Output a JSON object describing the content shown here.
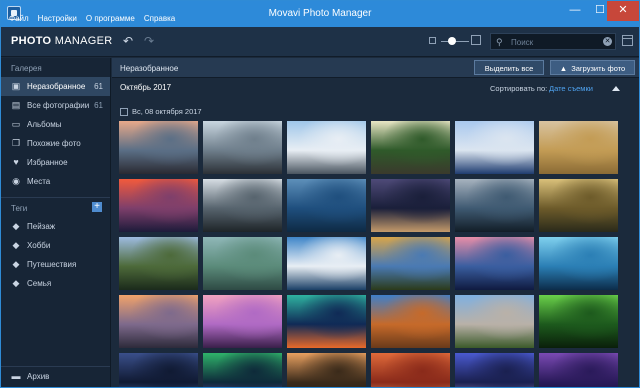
{
  "window": {
    "title": "Movavi Photo Manager",
    "min": "—",
    "max": "☐",
    "close": "✕"
  },
  "menu": [
    "Файл",
    "Настройки",
    "О программе",
    "Справка"
  ],
  "toolbar": {
    "logo_bold": "PHOTO",
    "logo_rest": " MANAGER",
    "undo": "↶",
    "redo": "↷",
    "search_placeholder": "Поиск",
    "search_icon": "⚲",
    "clear": "✕"
  },
  "sidebar": {
    "gallery_title": "Галерея",
    "items": [
      {
        "label": "Неразобранное",
        "count": "61",
        "icon": "inbox-icon",
        "glyph": "▣",
        "active": true
      },
      {
        "label": "Все фотографии",
        "count": "61",
        "icon": "photos-icon",
        "glyph": "▤"
      },
      {
        "label": "Альбомы",
        "count": "",
        "icon": "albums-icon",
        "glyph": "▭"
      },
      {
        "label": "Похожие фото",
        "count": "",
        "icon": "similar-icon",
        "glyph": "❐"
      },
      {
        "label": "Избранное",
        "count": "",
        "icon": "heart-icon",
        "glyph": "♥"
      },
      {
        "label": "Места",
        "count": "",
        "icon": "pin-icon",
        "glyph": "◉"
      }
    ],
    "tags_title": "Теги",
    "add_tag": "+",
    "tags": [
      {
        "label": "Пейзаж",
        "icon": "tag-icon",
        "glyph": "◆"
      },
      {
        "label": "Хобби",
        "icon": "tag-icon",
        "glyph": "◆"
      },
      {
        "label": "Путешествия",
        "icon": "tag-icon",
        "glyph": "◆"
      },
      {
        "label": "Семья",
        "icon": "tag-icon",
        "glyph": "◆"
      }
    ],
    "archive": {
      "label": "Архив",
      "icon": "archive-icon",
      "glyph": "▬"
    }
  },
  "main": {
    "header_title": "Неразобранное",
    "select_all": "Выделить все",
    "upload": "Загрузить фото",
    "upload_icon": "▲",
    "month": "Октябрь 2017",
    "sort_label": "Сортировать по:",
    "sort_value": "Дате съемки",
    "date_group": "Вс, 08 октября 2017"
  },
  "colors": {
    "accent": "#2d8ad9",
    "link": "#4fa3f0",
    "sidebar_bg": "#172536",
    "main_bg": "#1b2a3c"
  },
  "photos": [
    {
      "name": "pier-sunset",
      "c1": "#e8a98a",
      "c2": "#5b6f86",
      "c3": "#2a2a32"
    },
    {
      "name": "rocky-coast",
      "c1": "#c9d6e0",
      "c2": "#6f7f8c",
      "c3": "#2b3036"
    },
    {
      "name": "eagle",
      "c1": "#9fc6e9",
      "c2": "#e8eef4",
      "c3": "#4a5560"
    },
    {
      "name": "forest-road",
      "c1": "#e8e6c5",
      "c2": "#2f5a2a",
      "c3": "#3a3a2c"
    },
    {
      "name": "architecture",
      "c1": "#a9c8ee",
      "c2": "#dbe5f0",
      "c3": "#1f3c70"
    },
    {
      "name": "deer-field",
      "c1": "#d8c3a0",
      "c2": "#c39c55",
      "c3": "#8a6b35"
    },
    {
      "name": "red-sunset-lake",
      "c1": "#f25a3c",
      "c2": "#7e3f6b",
      "c3": "#1d1b3a"
    },
    {
      "name": "paraglider",
      "c1": "#d6dde3",
      "c2": "#57646e",
      "c3": "#1e2428"
    },
    {
      "name": "blue-coast",
      "c1": "#5d8fb9",
      "c2": "#1f4f7e",
      "c3": "#0e2a44"
    },
    {
      "name": "milky-way",
      "c1": "#4e4a78",
      "c2": "#1a1f3a",
      "c3": "#c49a6a"
    },
    {
      "name": "rice-terraces",
      "c1": "#a6b2be",
      "c2": "#3f5a72",
      "c3": "#121d27"
    },
    {
      "name": "castle-river",
      "c1": "#d9c07a",
      "c2": "#6d5b2a",
      "c3": "#2a2a1a"
    },
    {
      "name": "fairy-castle",
      "c1": "#9dbbe0",
      "c2": "#4d6a3a",
      "c3": "#1b2a1b"
    },
    {
      "name": "delta-aerial",
      "c1": "#8fb7b8",
      "c2": "#5b8b7a",
      "c3": "#2e4a44"
    },
    {
      "name": "windmills",
      "c1": "#3f86c9",
      "c2": "#e8eef4",
      "c3": "#1b3f66"
    },
    {
      "name": "autumn-lake",
      "c1": "#d8a54a",
      "c2": "#4a7ab3",
      "c3": "#2b3a1a"
    },
    {
      "name": "purple-sky",
      "c1": "#e88ea8",
      "c2": "#3a5ea0",
      "c3": "#0f1a40"
    },
    {
      "name": "lone-tree",
      "c1": "#7fd0ee",
      "c2": "#2b7fb5",
      "c3": "#0c2c4a"
    },
    {
      "name": "coast-tower",
      "c1": "#f1a36a",
      "c2": "#7e6a8c",
      "c3": "#2d2a3a"
    },
    {
      "name": "pink-beach",
      "c1": "#f2a2c0",
      "c2": "#b06ac4",
      "c3": "#3a1f4a"
    },
    {
      "name": "aurora-house",
      "c1": "#2fb3a0",
      "c2": "#102a56",
      "c3": "#e86a2a"
    },
    {
      "name": "canyon",
      "c1": "#3f7fc9",
      "c2": "#c66a2a",
      "c3": "#6a3a1a"
    },
    {
      "name": "dolomites",
      "c1": "#7fb0e0",
      "c2": "#b9b1a8",
      "c3": "#3b5a2a"
    },
    {
      "name": "green-forest",
      "c1": "#6ad04a",
      "c2": "#1d5a1d",
      "c3": "#0a1f0a"
    },
    {
      "name": "earth-globe",
      "c1": "#3a4f8a",
      "c2": "#101a33",
      "c3": "#5a7fc0"
    },
    {
      "name": "aurora-green",
      "c1": "#2fb36a",
      "c2": "#0e2a3a",
      "c3": "#7a4ab3"
    },
    {
      "name": "hot-air",
      "c1": "#e8a060",
      "c2": "#3a2a1a",
      "c3": "#1a1a1a"
    },
    {
      "name": "antelope",
      "c1": "#e06a3a",
      "c2": "#8a2a1a",
      "c3": "#f0b07a"
    },
    {
      "name": "city-night",
      "c1": "#4a5ad0",
      "c2": "#1a2050",
      "c3": "#c0a0e0"
    },
    {
      "name": "twilight",
      "c1": "#7a4ab3",
      "c2": "#2a1a5a",
      "c3": "#0a0a2a"
    }
  ]
}
